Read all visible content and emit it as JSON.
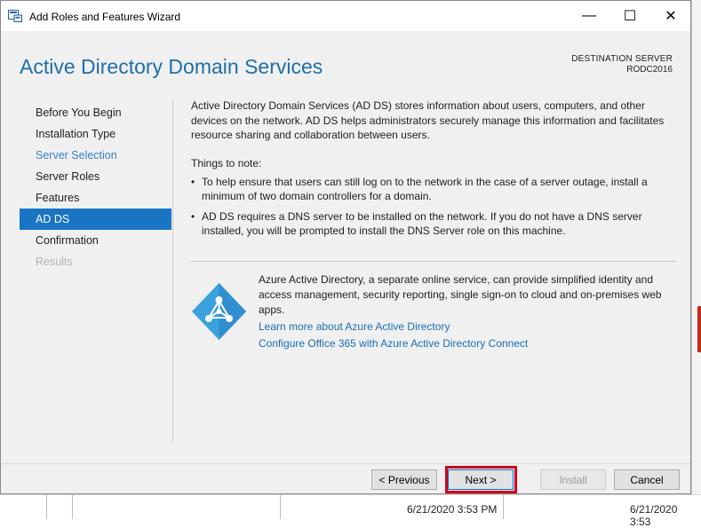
{
  "window": {
    "title": "Add Roles and Features Wizard",
    "minimize_glyph": "—",
    "maximize_glyph": "☐",
    "close_glyph": "✕"
  },
  "header": {
    "page_title": "Active Directory Domain Services",
    "destination_label": "DESTINATION SERVER",
    "destination_server": "RODC2016"
  },
  "nav": {
    "items": [
      {
        "label": "Before You Begin",
        "state": "normal"
      },
      {
        "label": "Installation Type",
        "state": "normal"
      },
      {
        "label": "Server Selection",
        "state": "link"
      },
      {
        "label": "Server Roles",
        "state": "normal"
      },
      {
        "label": "Features",
        "state": "normal"
      },
      {
        "label": "AD DS",
        "state": "active"
      },
      {
        "label": "Confirmation",
        "state": "normal"
      },
      {
        "label": "Results",
        "state": "disabled"
      }
    ]
  },
  "main": {
    "description": "Active Directory Domain Services (AD DS) stores information about users, computers, and other devices on the network.  AD DS helps administrators securely manage this information and facilitates resource sharing and collaboration between users.",
    "notes_heading": "Things to note:",
    "bullets": [
      "To help ensure that users can still log on to the network in the case of a server outage, install a minimum of two domain controllers for a domain.",
      "AD DS requires a DNS server to be installed on the network.  If you do not have a DNS server installed, you will be prompted to install the DNS Server role on this machine."
    ],
    "azure_text": "Azure Active Directory, a separate online service, can provide simplified identity and access management, security reporting, single sign-on to cloud and on-premises web apps.",
    "azure_link_1": "Learn more about Azure Active Directory",
    "azure_link_2": "Configure Office 365 with Azure Active Directory Connect"
  },
  "buttons": {
    "previous": "< Previous",
    "next": "Next >",
    "install": "Install",
    "cancel": "Cancel"
  },
  "background": {
    "time_1": "6/21/2020 3:53 PM",
    "time_2": "6/21/2020 3:53"
  },
  "colors": {
    "accent": "#1a74c4",
    "title_blue": "#1d6fa8",
    "link_blue": "#1a6eb5",
    "highlight_red": "#d0021b"
  }
}
